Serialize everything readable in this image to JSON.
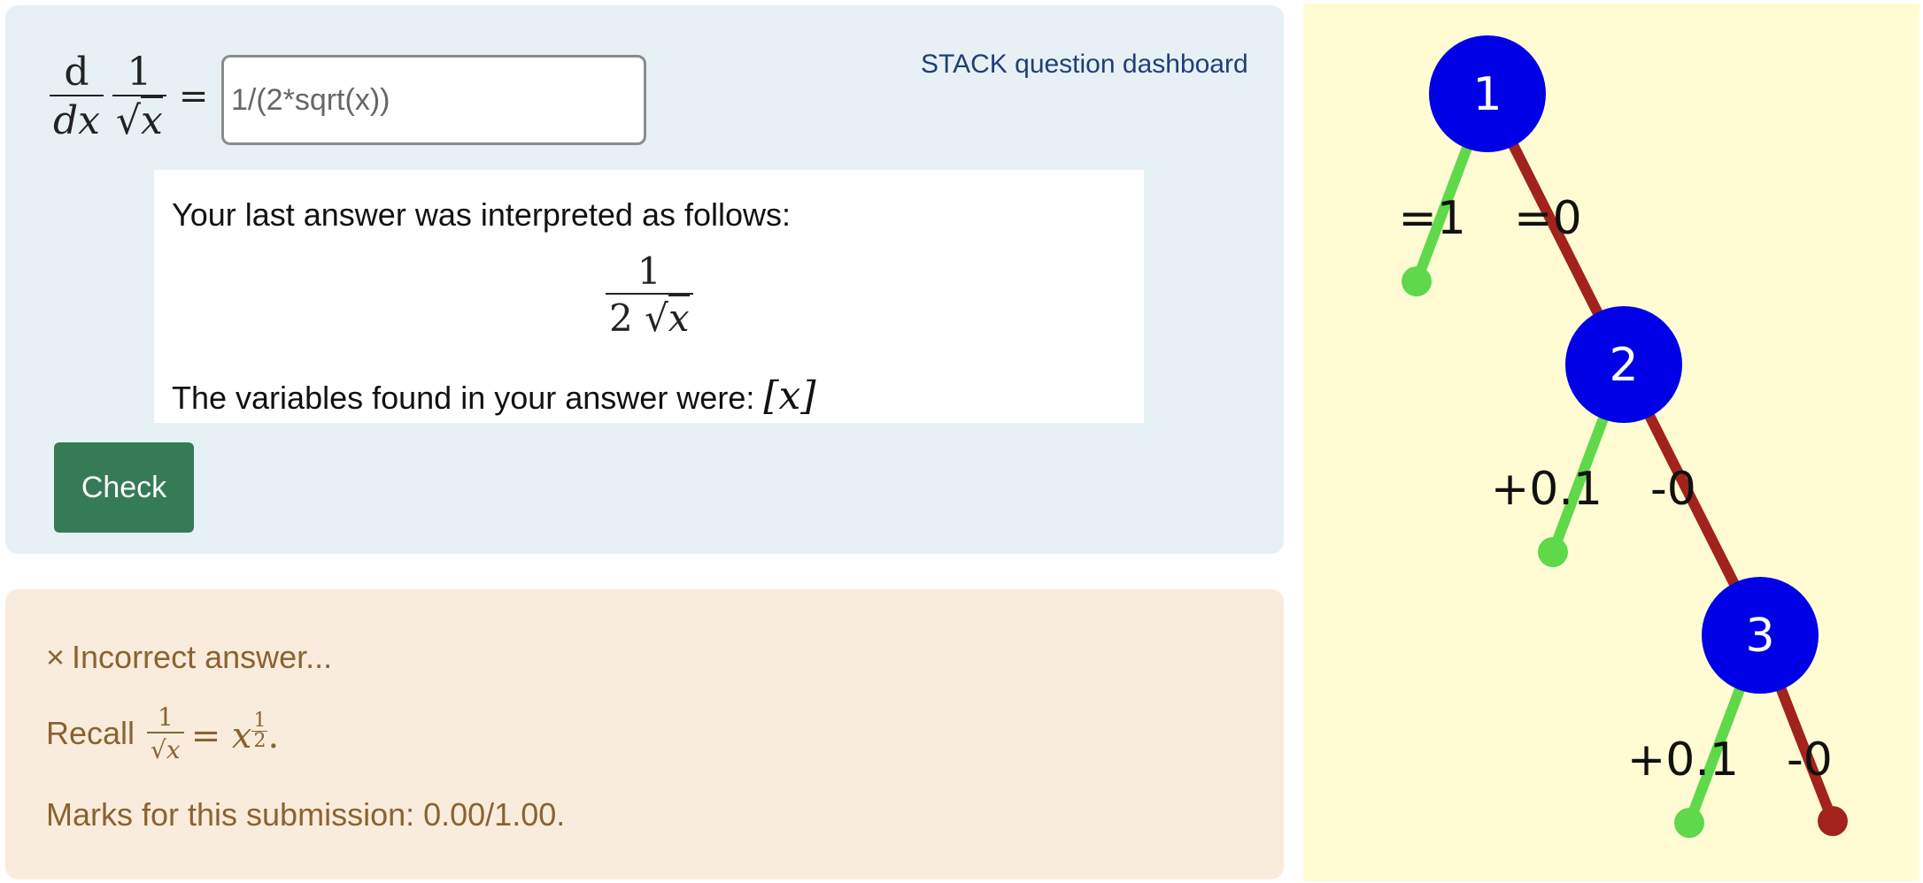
{
  "question": {
    "dashboard_link": "STACK question dashboard",
    "derivative_top": "d",
    "derivative_bottom": "dx",
    "fraction_numerator": "1",
    "sqrt_symbol": "√",
    "variable": "x",
    "equals": "=",
    "answer_value": "1/(2*sqrt(x))"
  },
  "validation": {
    "intro": "Your last answer was interpreted as follows:",
    "interpreted_numerator": "1",
    "interpreted_coefficient": "2",
    "variables_label": "The variables found in your answer were:",
    "variables_value": "[x]"
  },
  "check_button": "Check",
  "feedback": {
    "cross_icon": "×",
    "title": "Incorrect answer...",
    "recall_label": "Recall",
    "recall_equals": "=",
    "recall_exp_num": "1",
    "recall_exp_den": "2",
    "recall_period": ".",
    "marks": "Marks for this submission: 0.00/1.00."
  },
  "tree": {
    "nodes": [
      {
        "label": "1",
        "left_label": "=1",
        "right_label": "=0"
      },
      {
        "label": "2",
        "left_label": "+0.1",
        "right_label": "-0"
      },
      {
        "label": "3",
        "left_label": "+0.1",
        "right_label": "-0"
      }
    ],
    "colors": {
      "node": "#0000e6",
      "true_branch": "#5fd84a",
      "false_branch": "#a1231b",
      "background": "#fffcd4"
    }
  }
}
